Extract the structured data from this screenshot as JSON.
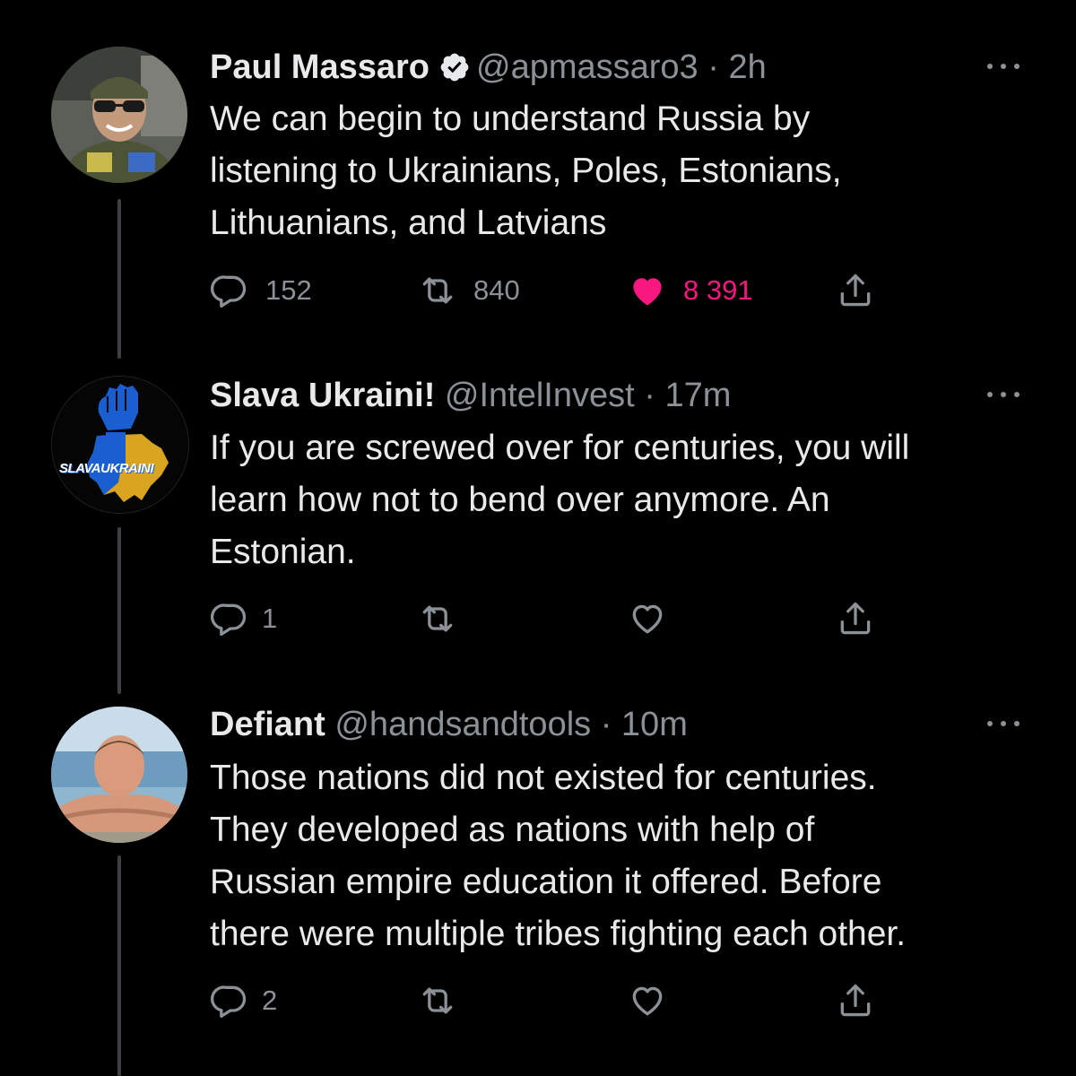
{
  "tweets": [
    {
      "name": "Paul Massaro",
      "handle": "@apmassaro3",
      "time": "2h",
      "verified": true,
      "lines": [
        "We can begin to understand Russia by",
        "listening to Ukrainians, Poles, Estonians,",
        "Lithuanians, and Latvians"
      ],
      "replies": "152",
      "retweets": "840",
      "likes": "8 391",
      "liked": true
    },
    {
      "name": "Slava Ukraini!",
      "handle": "@IntelInvest",
      "time": "17m",
      "verified": false,
      "avatar_text": "SLAVAUKRAINI",
      "lines": [
        "If you are screwed over for centuries, you will",
        "learn how not to bend over anymore. An",
        "Estonian."
      ],
      "replies": "1",
      "retweets": "",
      "likes": "",
      "liked": false
    },
    {
      "name": "Defiant",
      "handle": "@handsandtools",
      "time": "10m",
      "verified": false,
      "lines": [
        "Those nations did not existed for centuries.",
        "They developed as nations with help of",
        "Russian empire education it offered. Before",
        "there were multiple tribes fighting each other."
      ],
      "replies": "2",
      "retweets": "",
      "likes": "",
      "liked": false
    }
  ],
  "colors": {
    "background": "#000000",
    "text": "#e7e9ea",
    "muted": "#8b9196",
    "like": "#f91880",
    "thread_line": "#3e4144",
    "ukraine_blue": "#1a5fd1",
    "ukraine_yellow": "#d9a521"
  }
}
